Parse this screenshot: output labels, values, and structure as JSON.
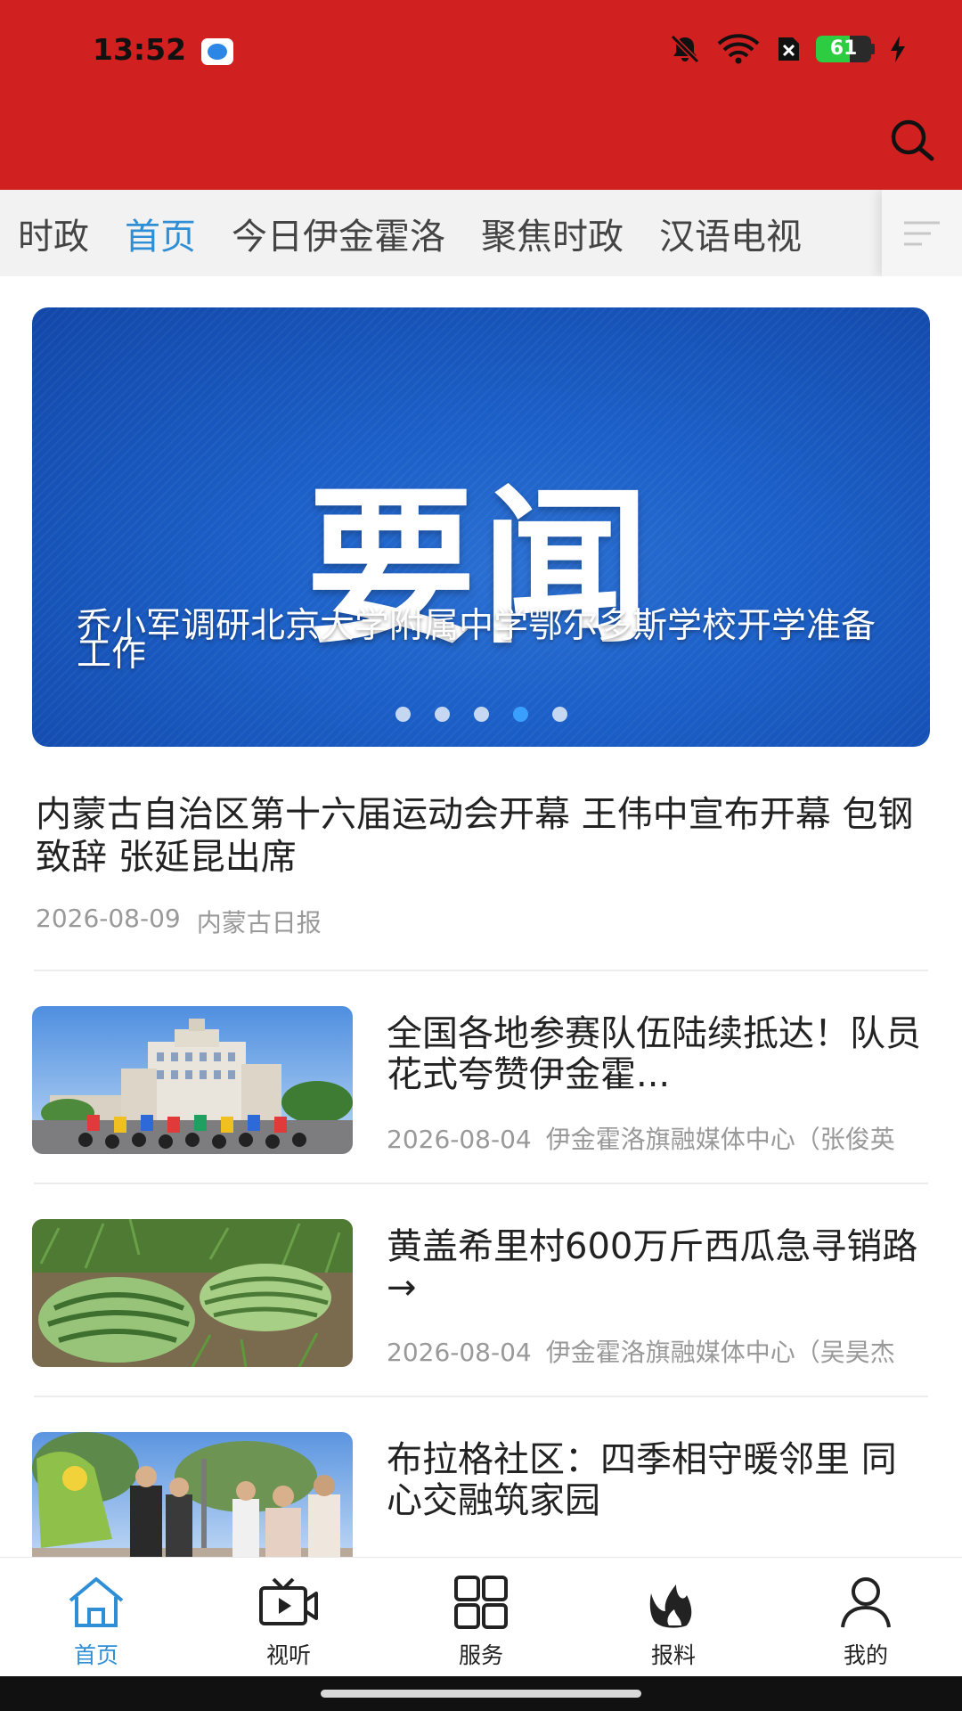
{
  "status_bar": {
    "time": "13:52",
    "battery": 61,
    "icons": [
      "app-icon",
      "mute-icon",
      "wifi-icon",
      "sim-icon",
      "battery-icon",
      "charging-icon"
    ]
  },
  "colors": {
    "header_bg": "#d0201f",
    "accent": "#2f8fd6",
    "tab_bar_bg": "#f2f2f2"
  },
  "tabs": [
    {
      "label": "时政",
      "active": false
    },
    {
      "label": "首页",
      "active": true
    },
    {
      "label": "今日伊金霍洛",
      "active": false
    },
    {
      "label": "聚焦时政",
      "active": false
    },
    {
      "label": "汉语电视",
      "active": false
    }
  ],
  "banner": {
    "big_text": "要闻",
    "caption": "乔小军调研北京大学附属中学鄂尔多斯学校开学准备工作",
    "dot_count": 5,
    "active_dot": 4
  },
  "feature": {
    "title": "内蒙古自治区第十六届运动会开幕 王伟中宣布开幕 包钢致辞 张延昆出席",
    "date": "2026-08-09",
    "source": "内蒙古日报"
  },
  "articles": [
    {
      "title": "全国各地参赛队伍陆续抵达！队员花式夸赞伊金霍...",
      "date": "2026-08-04",
      "source": "伊金霍洛旗融媒体中心（张俊英",
      "thumb": "cyclists-building"
    },
    {
      "title": "黄盖希里村600万斤西瓜急寻销路→",
      "date": "2026-08-04",
      "source": "伊金霍洛旗融媒体中心（吴昊杰",
      "thumb": "watermelons"
    },
    {
      "title": "布拉格社区：四季相守暖邻里 同心交融筑家园",
      "date": "",
      "source": "",
      "thumb": "community-event"
    }
  ],
  "bottom_nav": [
    {
      "label": "首页",
      "icon": "home-icon",
      "active": true
    },
    {
      "label": "视听",
      "icon": "video-icon",
      "active": false
    },
    {
      "label": "服务",
      "icon": "grid-icon",
      "active": false
    },
    {
      "label": "报料",
      "icon": "flame-icon",
      "active": false
    },
    {
      "label": "我的",
      "icon": "user-icon",
      "active": false
    }
  ]
}
